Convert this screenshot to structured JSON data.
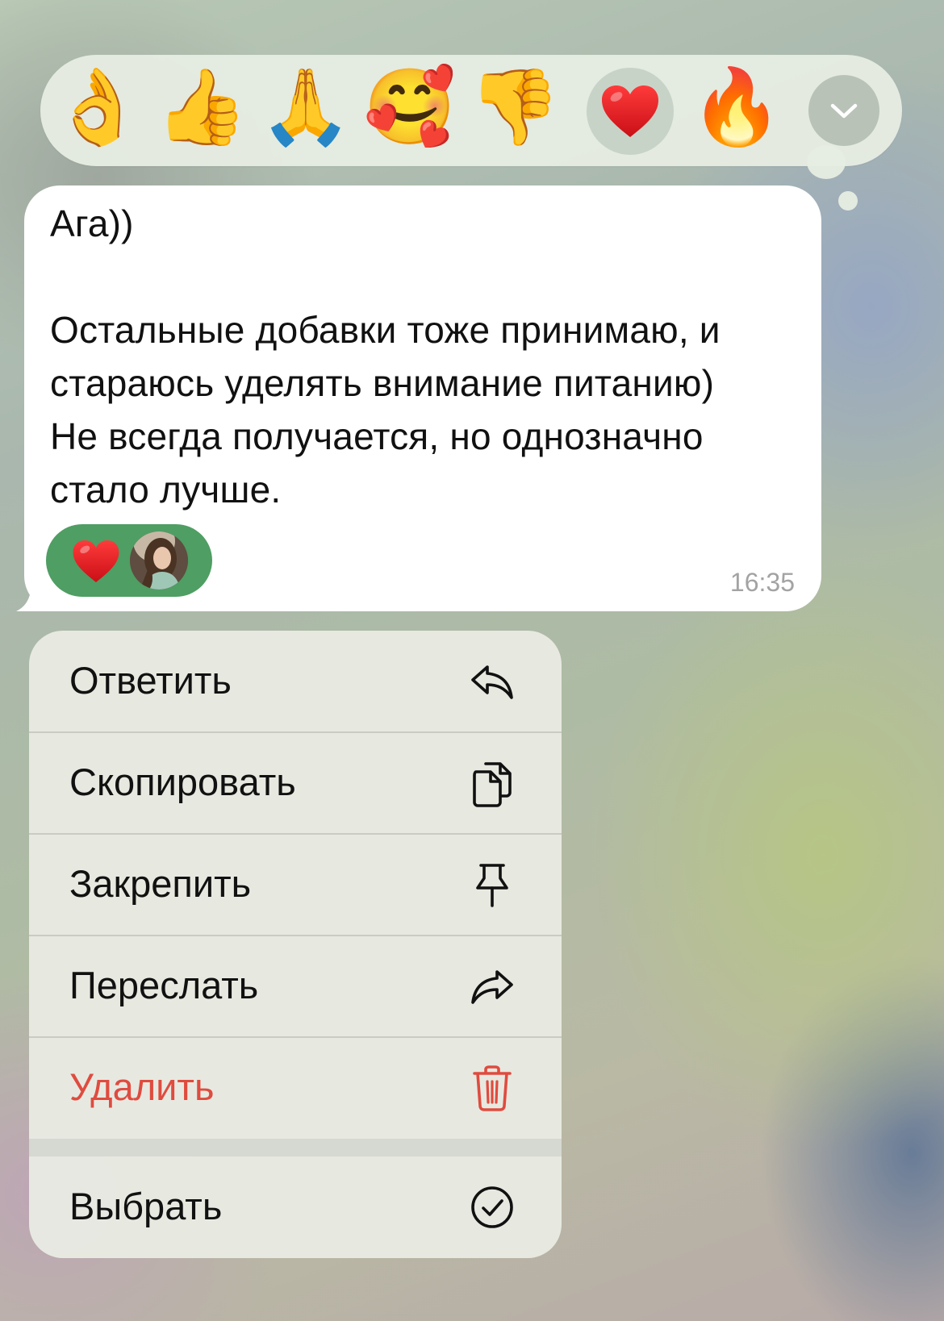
{
  "reaction_bar": {
    "emojis": [
      {
        "name": "ok-hand",
        "glyph": "👌",
        "selected": false
      },
      {
        "name": "thumbs-up",
        "glyph": "👍",
        "selected": false
      },
      {
        "name": "folded-hands",
        "glyph": "🙏",
        "selected": false
      },
      {
        "name": "smiling-face-with-hearts",
        "glyph": "🥰",
        "selected": false
      },
      {
        "name": "thumbs-down",
        "glyph": "👎",
        "selected": false
      },
      {
        "name": "red-heart",
        "glyph": "❤️",
        "selected": true
      },
      {
        "name": "fire",
        "glyph": "🔥",
        "selected": false
      }
    ],
    "expand_icon": "chevron-down-icon"
  },
  "message": {
    "lines": [
      "Ага))",
      "",
      "Остальные добавки тоже принимаю, и",
      "стараюсь уделять внимание питанию)",
      "Не всегда получается, но однозначно",
      "стало лучше."
    ],
    "reaction": {
      "emoji": "red-heart",
      "reactor_avatar": "avatar"
    },
    "time": "16:35"
  },
  "context_menu": {
    "items": [
      {
        "label": "Ответить",
        "icon": "reply-icon",
        "destructive": false
      },
      {
        "label": "Скопировать",
        "icon": "copy-icon",
        "destructive": false
      },
      {
        "label": "Закрепить",
        "icon": "pin-icon",
        "destructive": false
      },
      {
        "label": "Переслать",
        "icon": "forward-icon",
        "destructive": false
      },
      {
        "label": "Удалить",
        "icon": "trash-icon",
        "destructive": true
      },
      {
        "label": "Выбрать",
        "icon": "checkmark-circle-icon",
        "destructive": false
      }
    ]
  },
  "colors": {
    "reaction_chip": "#4f9e63",
    "destructive": "#e04b3f",
    "timestamp": "#a3a3a3",
    "bubble": "#ffffff"
  }
}
